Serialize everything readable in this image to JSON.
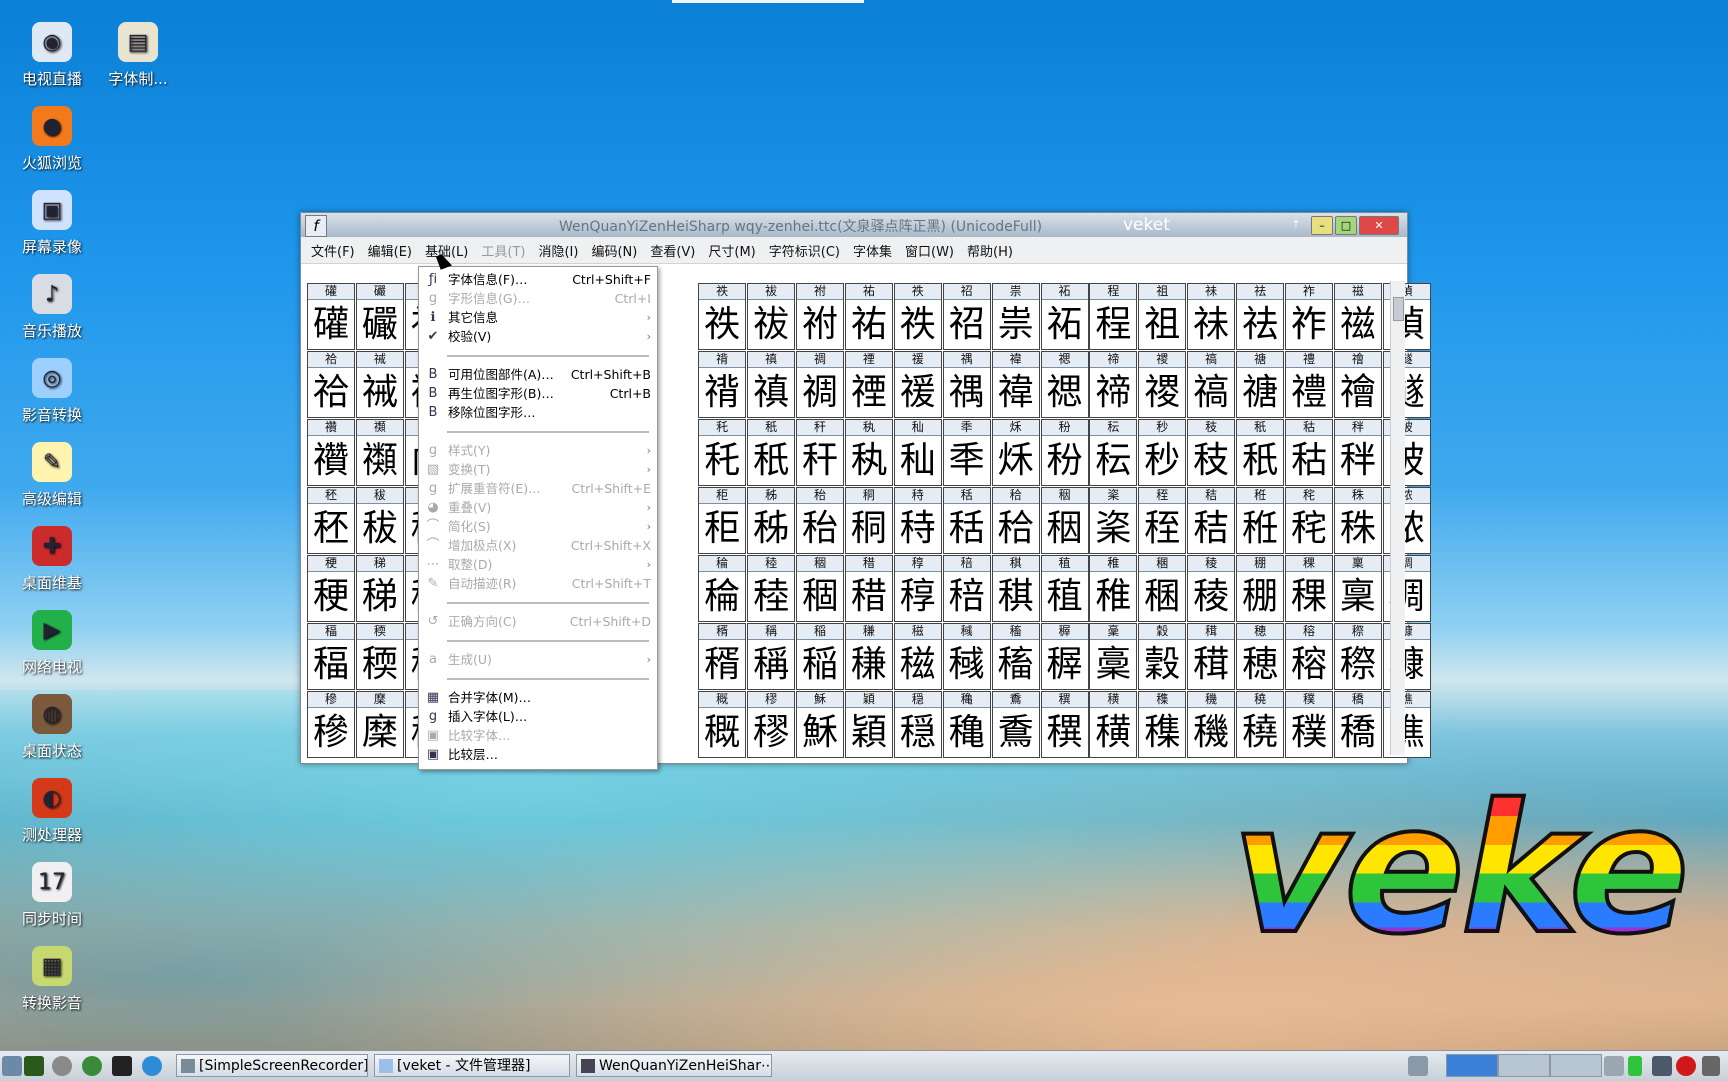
{
  "desktop": {
    "icons": [
      {
        "label": "电视直播",
        "glyph": "◉",
        "color": "#dfe8f5"
      },
      {
        "label": "字体制...",
        "glyph": "▤",
        "color": "#e9e4d0"
      },
      {
        "label": "火狐浏览",
        "glyph": "●",
        "color": "#f27a1a"
      },
      {
        "label": "屏幕录像",
        "glyph": "▣",
        "color": "#cfe3ff"
      },
      {
        "label": "音乐播放",
        "glyph": "♪",
        "color": "#d9dde3"
      },
      {
        "label": "影音转换",
        "glyph": "◎",
        "color": "#9ed0ff"
      },
      {
        "label": "高级编辑",
        "glyph": "✎",
        "color": "#fff3b0"
      },
      {
        "label": "桌面维基",
        "glyph": "✚",
        "color": "#cc2b2b"
      },
      {
        "label": "网络电视",
        "glyph": "▶",
        "color": "#21b04a"
      },
      {
        "label": "桌面状态",
        "glyph": "◍",
        "color": "#7a5a3a"
      },
      {
        "label": "测处理器",
        "glyph": "◐",
        "color": "#d43a1a"
      },
      {
        "label": "同步时间",
        "glyph": "17",
        "color": "#f0f0f0"
      },
      {
        "label": "转换影音",
        "glyph": "▦",
        "color": "#c8d870"
      }
    ],
    "logo_text": "veke"
  },
  "window": {
    "title": "WenQuanYiZenHeiSharp   wqy-zenhei.ttc(文泉驿点阵正黑)  (UnicodeFull)",
    "title_right": "veket",
    "menu": [
      {
        "label": "文件(F)",
        "disabled": false
      },
      {
        "label": "编辑(E)",
        "disabled": false
      },
      {
        "label": "基础(L)",
        "disabled": false
      },
      {
        "label": "工具(T)",
        "disabled": true
      },
      {
        "label": "消隐(I)",
        "disabled": false
      },
      {
        "label": "编码(N)",
        "disabled": false
      },
      {
        "label": "查看(V)",
        "disabled": false
      },
      {
        "label": "尺寸(M)",
        "disabled": false
      },
      {
        "label": "字符标识(C)",
        "disabled": false
      },
      {
        "label": "字体集",
        "disabled": false
      },
      {
        "label": "窗口(W)",
        "disabled": false
      },
      {
        "label": "帮助(H)",
        "disabled": false
      }
    ],
    "glyph_rows": [
      [
        "礶",
        "礹",
        "礽",
        "",
        "",
        "",
        "",
        "",
        "祑",
        "祓",
        "祔",
        "祐",
        "祑",
        "祒",
        "祟",
        "祏",
        "程",
        "祖",
        "祙",
        "祛",
        "祚",
        "禌",
        "禎"
      ],
      [
        "祫",
        "祴",
        "祵",
        "",
        "",
        "",
        "",
        "",
        "禙",
        "禛",
        "禂",
        "禋",
        "禐",
        "禑",
        "禕",
        "禗",
        "禘",
        "禝",
        "禞",
        "禟",
        "禮",
        "禬",
        "禭"
      ],
      [
        "禶",
        "禷",
        "禸",
        "",
        "",
        "",
        "",
        "",
        "秅",
        "秖",
        "秆",
        "秇",
        "秈",
        "秊",
        "秌",
        "秎",
        "秐",
        "秒",
        "秓",
        "秖",
        "秙",
        "秚",
        "秛"
      ],
      [
        "秠",
        "秡",
        "秢",
        "",
        "",
        "",
        "",
        "",
        "秬",
        "秭",
        "秮",
        "秱",
        "秲",
        "秳",
        "秴",
        "秵",
        "秶",
        "秷",
        "秸",
        "秹",
        "秺",
        "秼",
        "秾"
      ],
      [
        "稉",
        "稊",
        "稌",
        "",
        "",
        "",
        "",
        "",
        "稐",
        "稑",
        "稒",
        "稓",
        "稕",
        "稖",
        "稘",
        "稙",
        "稚",
        "稛",
        "稜",
        "稝",
        "稞",
        "稟",
        "稠"
      ],
      [
        "稫",
        "稬",
        "稭",
        "",
        "",
        "",
        "",
        "",
        "稰",
        "稱",
        "稲",
        "稴",
        "稵",
        "稶",
        "稸",
        "稺",
        "稾",
        "穀",
        "穁",
        "穂",
        "穃",
        "穄",
        "穅"
      ],
      [
        "穇",
        "穈",
        "穉",
        "",
        "",
        "",
        "",
        "",
        "穊",
        "穋",
        "穌",
        "穎",
        "穏",
        "穐",
        "穒",
        "穓",
        "穔",
        "穕",
        "穖",
        "穘",
        "穙",
        "穚",
        "穛"
      ]
    ],
    "glyph_rows_note_colgap": "",
    "visible_glyphs": [
      [
        "礶",
        "礹",
        "礽",
        "",
        "",
        "",
        "",
        "祑",
        "祓",
        "祔",
        "祐",
        "祑",
        "祒",
        "祟",
        "祏",
        "程",
        "祖",
        "祙",
        "祛",
        "祚",
        "禌",
        "禎",
        "禎"
      ]
    ]
  },
  "dropdown": {
    "items": [
      {
        "type": "item",
        "icon": "ƒi",
        "label": "字体信息(F)…",
        "shortcut": "Ctrl+Shift+F",
        "disabled": false
      },
      {
        "type": "item",
        "icon": "g",
        "label": "字形信息(G)…",
        "shortcut": "Ctrl+I",
        "disabled": true
      },
      {
        "type": "item",
        "icon": "ℹ",
        "label": "其它信息",
        "shortcut": "",
        "disabled": false,
        "submenu": true
      },
      {
        "type": "item",
        "icon": "✔",
        "label": "校验(V)",
        "shortcut": "",
        "disabled": false,
        "submenu": true
      },
      {
        "type": "sep"
      },
      {
        "type": "item",
        "icon": "B",
        "label": "可用位图部件(A)…",
        "shortcut": "Ctrl+Shift+B",
        "disabled": false
      },
      {
        "type": "item",
        "icon": "B",
        "label": "再生位图字形(B)…",
        "shortcut": "Ctrl+B",
        "disabled": false
      },
      {
        "type": "item",
        "icon": "B",
        "label": "移除位图字形…",
        "shortcut": "",
        "disabled": false
      },
      {
        "type": "sep"
      },
      {
        "type": "item",
        "icon": "g",
        "label": "样式(Y)",
        "shortcut": "",
        "disabled": true,
        "submenu": true
      },
      {
        "type": "item",
        "icon": "▧",
        "label": "变换(T)",
        "shortcut": "",
        "disabled": true,
        "submenu": true
      },
      {
        "type": "item",
        "icon": "g",
        "label": "扩展重音符(E)…",
        "shortcut": "Ctrl+Shift+E",
        "disabled": true
      },
      {
        "type": "item",
        "icon": "◕",
        "label": "重叠(V)",
        "shortcut": "",
        "disabled": true,
        "submenu": true
      },
      {
        "type": "item",
        "icon": "⌒",
        "label": "简化(S)",
        "shortcut": "",
        "disabled": true,
        "submenu": true
      },
      {
        "type": "item",
        "icon": "⌒",
        "label": "增加极点(X)",
        "shortcut": "Ctrl+Shift+X",
        "disabled": true
      },
      {
        "type": "item",
        "icon": "⋯",
        "label": "取整(D)",
        "shortcut": "",
        "disabled": true,
        "submenu": true
      },
      {
        "type": "item",
        "icon": "✎",
        "label": "自动描迹(R)",
        "shortcut": "Ctrl+Shift+T",
        "disabled": true
      },
      {
        "type": "sep"
      },
      {
        "type": "item",
        "icon": "↺",
        "label": "正确方向(C)",
        "shortcut": "Ctrl+Shift+D",
        "disabled": true
      },
      {
        "type": "sep"
      },
      {
        "type": "item",
        "icon": "a",
        "label": "生成(U)",
        "shortcut": "",
        "disabled": true,
        "submenu": true
      },
      {
        "type": "sep"
      },
      {
        "type": "item",
        "icon": "▦",
        "label": "合并字体(M)…",
        "shortcut": "",
        "disabled": false
      },
      {
        "type": "item",
        "icon": "g",
        "label": "插入字体(L)…",
        "shortcut": "",
        "disabled": false
      },
      {
        "type": "item",
        "icon": "▣",
        "label": "比较字体…",
        "shortcut": "",
        "disabled": true
      },
      {
        "type": "item",
        "icon": "▣",
        "label": "比较层…",
        "shortcut": "",
        "disabled": false
      }
    ]
  },
  "taskbar": {
    "tasks": [
      {
        "label": "[SimpleScreenRecorder]"
      },
      {
        "label": "[veket - 文件管理器]"
      },
      {
        "label": "WenQuanYiZenHeiShar⋯"
      }
    ]
  }
}
